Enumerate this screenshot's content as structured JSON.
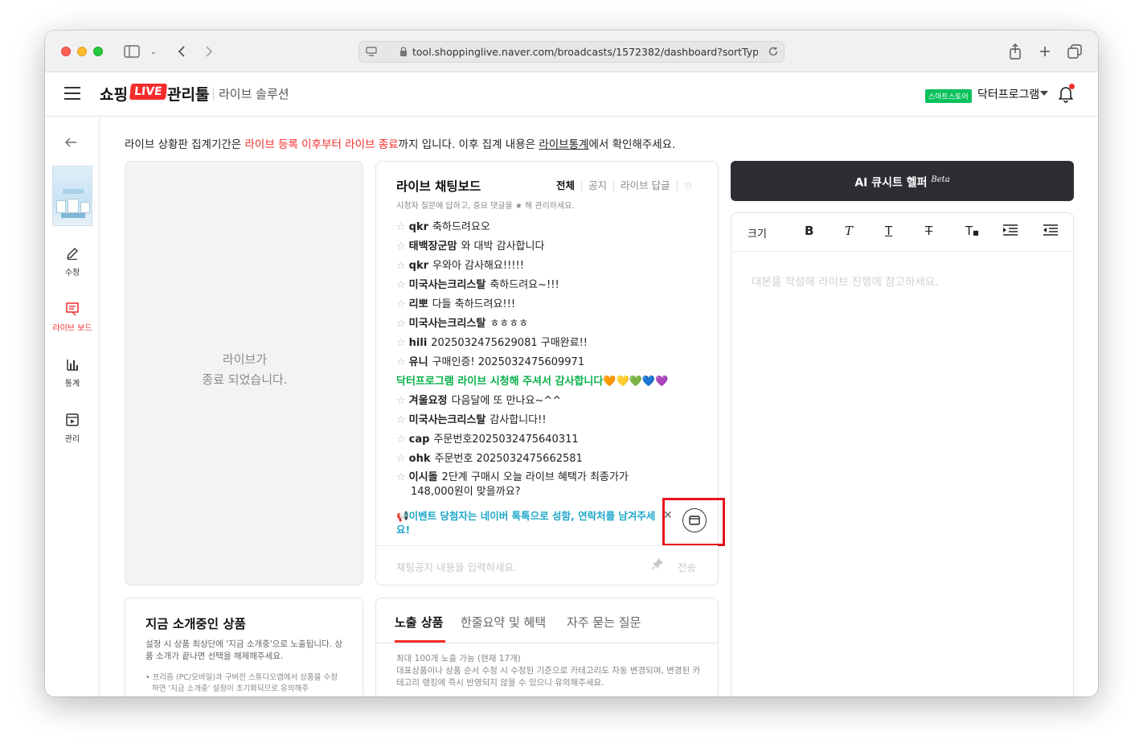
{
  "browser": {
    "url": "tool.shoppinglive.naver.com/broadcasts/1572382/dashboard?sortType="
  },
  "header": {
    "logo_prefix": "쇼핑",
    "logo_live": "LIVE",
    "logo_suffix": "관리툴",
    "subtitle": "라이브 솔루션",
    "store_badge": "스마트스토어",
    "store_name": "닥터프로그램"
  },
  "sidebar": {
    "items": [
      {
        "label": "수정",
        "icon": "pencil-icon"
      },
      {
        "label": "라이브 보드",
        "icon": "live-board-icon"
      },
      {
        "label": "통계",
        "icon": "bar-chart-icon"
      },
      {
        "label": "관리",
        "icon": "play-manage-icon"
      }
    ]
  },
  "notice": {
    "prefix": "라이브 상황판 집계기간은 ",
    "highlight": "라이브 등록 이후부터 라이브 종료",
    "middle": "까지 입니다. 이후 집계 내용은 ",
    "link": "라이브통계",
    "suffix": "에서 확인해주세요."
  },
  "video": {
    "line1": "라이브가",
    "line2": "종료 되었습니다."
  },
  "chat": {
    "title": "라이브 채팅보드",
    "description": "시청자 질문에 답하고, 중요 댓글을 ★ 해 관리하세요.",
    "tabs": [
      "전체",
      "공지",
      "라이브 답글"
    ],
    "messages": [
      {
        "nick": "qkr",
        "text": "축하드려요오"
      },
      {
        "nick": "태백장군맘",
        "text": "와 대박 감사합니다"
      },
      {
        "nick": "qkr",
        "text": "우와아 감사해요!!!!!"
      },
      {
        "nick": "미국사는크리스탈",
        "text": "축하드려요~!!!"
      },
      {
        "nick": "리뽀",
        "text": "다들 축하드려요!!!"
      },
      {
        "nick": "미국사는크리스탈",
        "text": "ㅎㅎㅎㅎ"
      },
      {
        "nick": "hili",
        "text": "2025032475629081 구매완료!!"
      },
      {
        "nick": "유니",
        "text": "구매인증! 2025032475609971"
      }
    ],
    "host_message": "닥터프로그램 라이브 시청해 주셔서 감사합니다🧡💛💚💙💜",
    "messages2": [
      {
        "nick": "겨울요정",
        "text": "다음달에 또 만나요~^^"
      },
      {
        "nick": "미국사는크리스탈",
        "text": "감사합니다!!"
      },
      {
        "nick": "cap",
        "text": "주문번호2025032475640311"
      },
      {
        "nick": "ohk",
        "text": "주문번호 2025032475662581"
      }
    ],
    "long_message": {
      "nick": "이시돌",
      "text": "2단계 구매시 오늘 라이브 혜택가 최종가가 148,000원이 맞을까요?"
    },
    "pinned_notice": "📢이벤트 당첨자는 네이버 톡톡으로 성함, 연락처를 남겨주세요!",
    "input_placeholder": "채팅공지 내용을 입력하세요.",
    "send_label": "전송"
  },
  "ai_helper": {
    "label": "AI 큐시트 헬퍼",
    "beta": "Beta"
  },
  "editor": {
    "size_label": "크기",
    "bold": "B",
    "italic": "T",
    "underline": "T",
    "strike": "T",
    "clear": "T",
    "placeholder": "대본을 작성해 라이브 진행에 참고하세요."
  },
  "current_product": {
    "title": "지금 소개중인 상품",
    "description": "설정 시 상품 최상단에 '지금 소개중'으로 노출됩니다. 상품 소개가 끝나면 선택을 해제해주세요.",
    "note": "• 프리즘 (PC/모바일)과 구버전 스튜디오앱에서 상품을 수정하면 '지금 소개중' 설정이 초기화되므로 유의해주"
  },
  "product_tabs": {
    "tabs": [
      "노출 상품",
      "한줄요약 및 혜택",
      "자주 묻는 질문"
    ],
    "info_line1": "최대 100개 노출 가능 (현재 17개)",
    "info_line2": "대표상품이나 상품 순서 수정 시 수정된 기준으로 카테고리도 자동 변경되며, 변경된 카테고리 랭킹에 즉시 반영되지 않을 수 있으니 유의해주세요."
  },
  "colors": {
    "brand_red": "#f32c2c",
    "host_green": "#07b148",
    "notice_cyan": "#1ea7c9",
    "highlight_box": "#e8121b"
  }
}
